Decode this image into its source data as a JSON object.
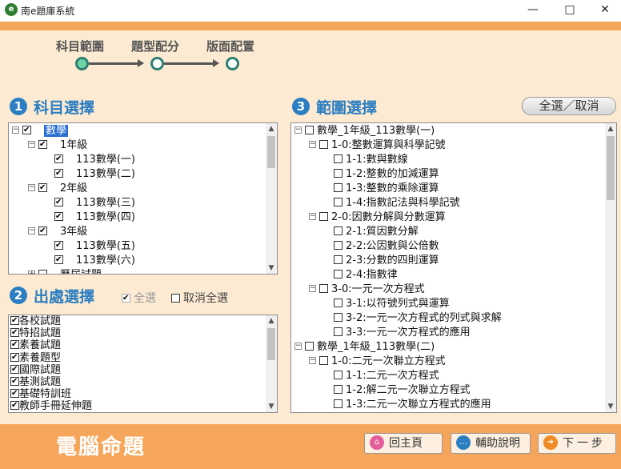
{
  "window": {
    "title": "南e題庫系統",
    "logo_glyph": "e",
    "min": "—",
    "max": "□",
    "close": "✕"
  },
  "steps": [
    {
      "label": "科目範圍",
      "active": true
    },
    {
      "label": "題型配分",
      "active": false
    },
    {
      "label": "版面配置",
      "active": false
    }
  ],
  "section1": {
    "num": "1",
    "title": "科目選擇"
  },
  "section2": {
    "num": "2",
    "title": "出處選擇",
    "select_all": "全選",
    "deselect_all": "取消全選"
  },
  "section3": {
    "num": "3",
    "title": "範圍選擇",
    "toggle_button": "全選／取消"
  },
  "subject_tree": [
    {
      "level": 0,
      "expander": "⊟",
      "checked": true,
      "label": "數學",
      "selected": true
    },
    {
      "level": 1,
      "expander": "⊟",
      "checked": true,
      "label": "1年級"
    },
    {
      "level": 2,
      "expander": "",
      "checked": true,
      "label": "113數學(一)"
    },
    {
      "level": 2,
      "expander": "",
      "checked": true,
      "label": "113數學(二)"
    },
    {
      "level": 1,
      "expander": "⊟",
      "checked": true,
      "label": "2年級"
    },
    {
      "level": 2,
      "expander": "",
      "checked": true,
      "label": "113數學(三)"
    },
    {
      "level": 2,
      "expander": "",
      "checked": true,
      "label": "113數學(四)"
    },
    {
      "level": 1,
      "expander": "⊟",
      "checked": true,
      "label": "3年級"
    },
    {
      "level": 2,
      "expander": "",
      "checked": true,
      "label": "113數學(五)"
    },
    {
      "level": 2,
      "expander": "",
      "checked": true,
      "label": "113數學(六)"
    },
    {
      "level": 1,
      "expander": "⊞",
      "checked": false,
      "label": "歷屆試題"
    }
  ],
  "source_list": [
    {
      "checked": true,
      "label": "各校試題"
    },
    {
      "checked": true,
      "label": "特招試題"
    },
    {
      "checked": true,
      "label": "素養試題"
    },
    {
      "checked": true,
      "label": "素養題型"
    },
    {
      "checked": true,
      "label": "國際試題"
    },
    {
      "checked": true,
      "label": "基測試題"
    },
    {
      "checked": true,
      "label": "基礎特訓班"
    },
    {
      "checked": true,
      "label": "教師手冊延伸題"
    }
  ],
  "range_tree": [
    {
      "level": 0,
      "expander": "⊟",
      "label": "數學_1年級_113數學(一)"
    },
    {
      "level": 1,
      "expander": "⊟",
      "label": "1-0:整數運算與科學記號"
    },
    {
      "level": 2,
      "expander": "",
      "label": "1-1:數與數線"
    },
    {
      "level": 2,
      "expander": "",
      "label": "1-2:整數的加減運算"
    },
    {
      "level": 2,
      "expander": "",
      "label": "1-3:整數的乘除運算"
    },
    {
      "level": 2,
      "expander": "",
      "label": "1-4:指數記法與科學記號"
    },
    {
      "level": 1,
      "expander": "⊟",
      "label": "2-0:因數分解與分數運算"
    },
    {
      "level": 2,
      "expander": "",
      "label": "2-1:質因數分解"
    },
    {
      "level": 2,
      "expander": "",
      "label": "2-2:公因數與公倍數"
    },
    {
      "level": 2,
      "expander": "",
      "label": "2-3:分數的四則運算"
    },
    {
      "level": 2,
      "expander": "",
      "label": "2-4:指數律"
    },
    {
      "level": 1,
      "expander": "⊟",
      "label": "3-0:一元一次方程式"
    },
    {
      "level": 2,
      "expander": "",
      "label": "3-1:以符號列式與運算"
    },
    {
      "level": 2,
      "expander": "",
      "label": "3-2:一元一次方程式的列式與求解"
    },
    {
      "level": 2,
      "expander": "",
      "label": "3-3:一元一次方程式的應用"
    },
    {
      "level": 0,
      "expander": "⊟",
      "label": "數學_1年級_113數學(二)"
    },
    {
      "level": 1,
      "expander": "⊟",
      "label": "1-0:二元一次聯立方程式"
    },
    {
      "level": 2,
      "expander": "",
      "label": "1-1:二元一次方程式"
    },
    {
      "level": 2,
      "expander": "",
      "label": "1-2:解二元一次聯立方程式"
    },
    {
      "level": 2,
      "expander": "",
      "label": "1-3:二元一次聯立方程式的應用"
    }
  ],
  "footer": {
    "title": "電腦命題",
    "home": "回主頁",
    "help": "輔助說明",
    "next": "下一步"
  },
  "colors": {
    "accent_blue": "#2b7ec1",
    "orange": "#f6a65a",
    "panel_bg": "#fcebd2",
    "step_teal": "#2d7f74"
  }
}
